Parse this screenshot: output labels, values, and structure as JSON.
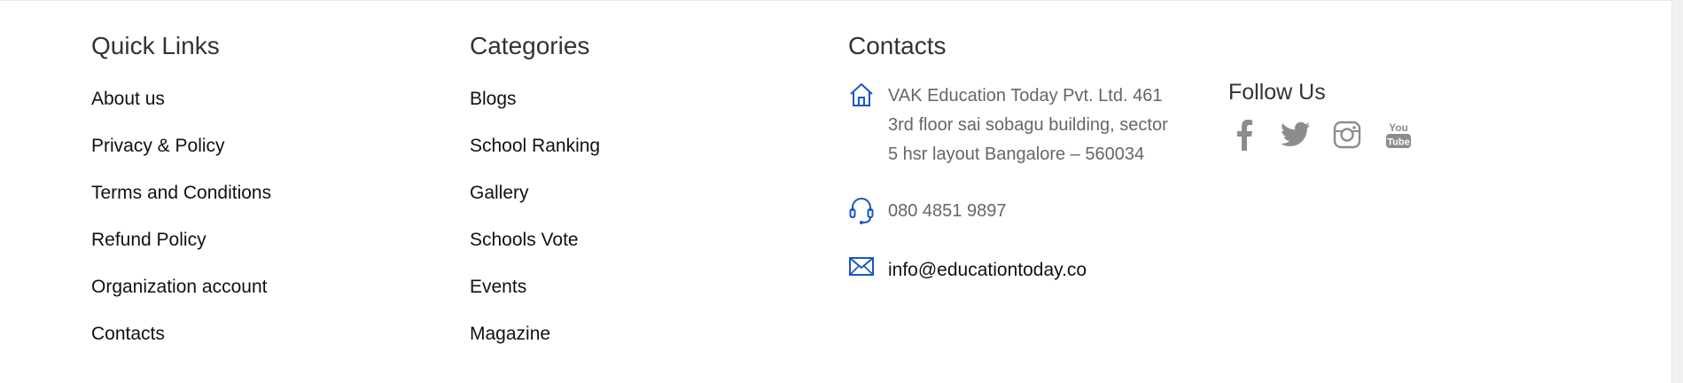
{
  "quick_links": {
    "title": "Quick Links",
    "items": [
      "About us",
      "Privacy & Policy",
      "Terms and Conditions",
      "Refund Policy",
      "Organization account",
      "Contacts"
    ]
  },
  "categories": {
    "title": "Categories",
    "items": [
      "Blogs",
      "School Ranking",
      "Gallery",
      "Schools Vote",
      "Events",
      "Magazine"
    ]
  },
  "contacts": {
    "title": "Contacts",
    "address_lines": [
      "VAK Education Today Pvt. Ltd. 461",
      "3rd floor sai sobagu building, sector",
      "5 hsr layout Bangalore – 560034"
    ],
    "phone": "080 4851 9897",
    "email": "info@educationtoday.co",
    "icons": {
      "address": "home-icon",
      "phone": "headset-icon",
      "email": "mail-icon"
    },
    "icon_color": "#1a56c7"
  },
  "follow_us": {
    "title": "Follow Us",
    "networks": [
      "facebook-icon",
      "twitter-icon",
      "instagram-icon",
      "youtube-icon"
    ],
    "icon_color": "#8c8c8c"
  }
}
